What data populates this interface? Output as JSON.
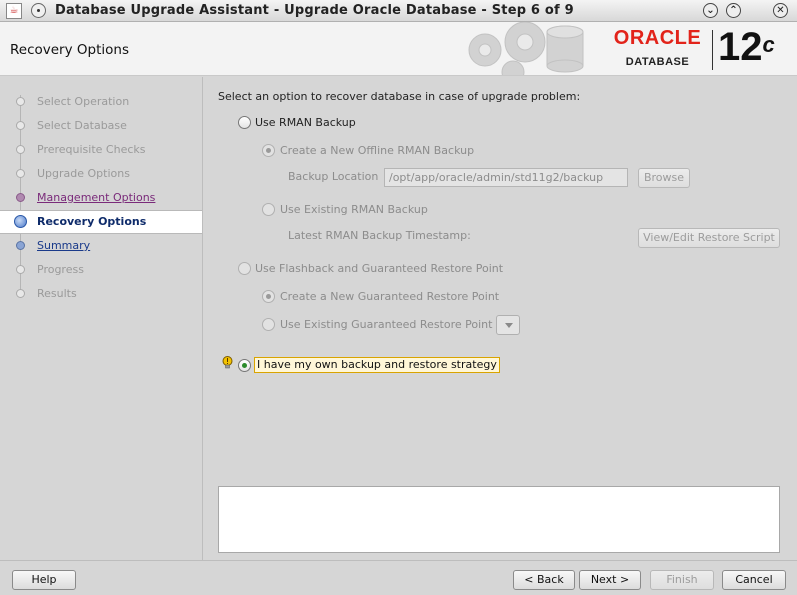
{
  "window": {
    "title": "Database Upgrade Assistant - Upgrade Oracle Database - Step 6 of 9",
    "controls": [
      "minimize",
      "maximize",
      "close"
    ]
  },
  "header": {
    "page_title": "Recovery Options",
    "logo_brand": "ORACLE",
    "logo_sub": "DATABASE",
    "version": "12",
    "version_suffix": "c"
  },
  "steps": [
    {
      "label": "Select Operation",
      "state": "done"
    },
    {
      "label": "Select Database",
      "state": "done"
    },
    {
      "label": "Prerequisite Checks",
      "state": "done"
    },
    {
      "label": "Upgrade Options",
      "state": "done"
    },
    {
      "label": "Management Options",
      "state": "visited"
    },
    {
      "label": "Recovery Options",
      "state": "current"
    },
    {
      "label": "Summary",
      "state": "link"
    },
    {
      "label": "Progress",
      "state": "pending"
    },
    {
      "label": "Results",
      "state": "pending"
    }
  ],
  "content": {
    "prompt": "Select an option to recover database in case of upgrade problem:",
    "rman": {
      "label": "Use RMAN Backup",
      "create_new_label": "Create a New Offline RMAN Backup",
      "backup_location_label": "Backup Location",
      "backup_location_value": "/opt/app/oracle/admin/std11g2/backup",
      "browse_label": "Browse",
      "use_existing_label": "Use Existing RMAN Backup",
      "timestamp_label": "Latest RMAN Backup Timestamp:",
      "view_edit_label": "View/Edit Restore Script"
    },
    "flashback": {
      "label": "Use Flashback and Guaranteed Restore Point",
      "create_new_label": "Create a New Guaranteed Restore Point",
      "use_existing_label": "Use Existing Guaranteed Restore Point"
    },
    "own_strategy": {
      "label": "I have my own backup and restore strategy",
      "selected": true
    }
  },
  "buttons": {
    "help": "Help",
    "back": "< Back",
    "next": "Next >",
    "finish": "Finish",
    "cancel": "Cancel"
  },
  "colors": {
    "oracle_red": "#e2231a",
    "selection_green": "#2a8a2a",
    "current_step_blue": "#0e2b6a"
  }
}
